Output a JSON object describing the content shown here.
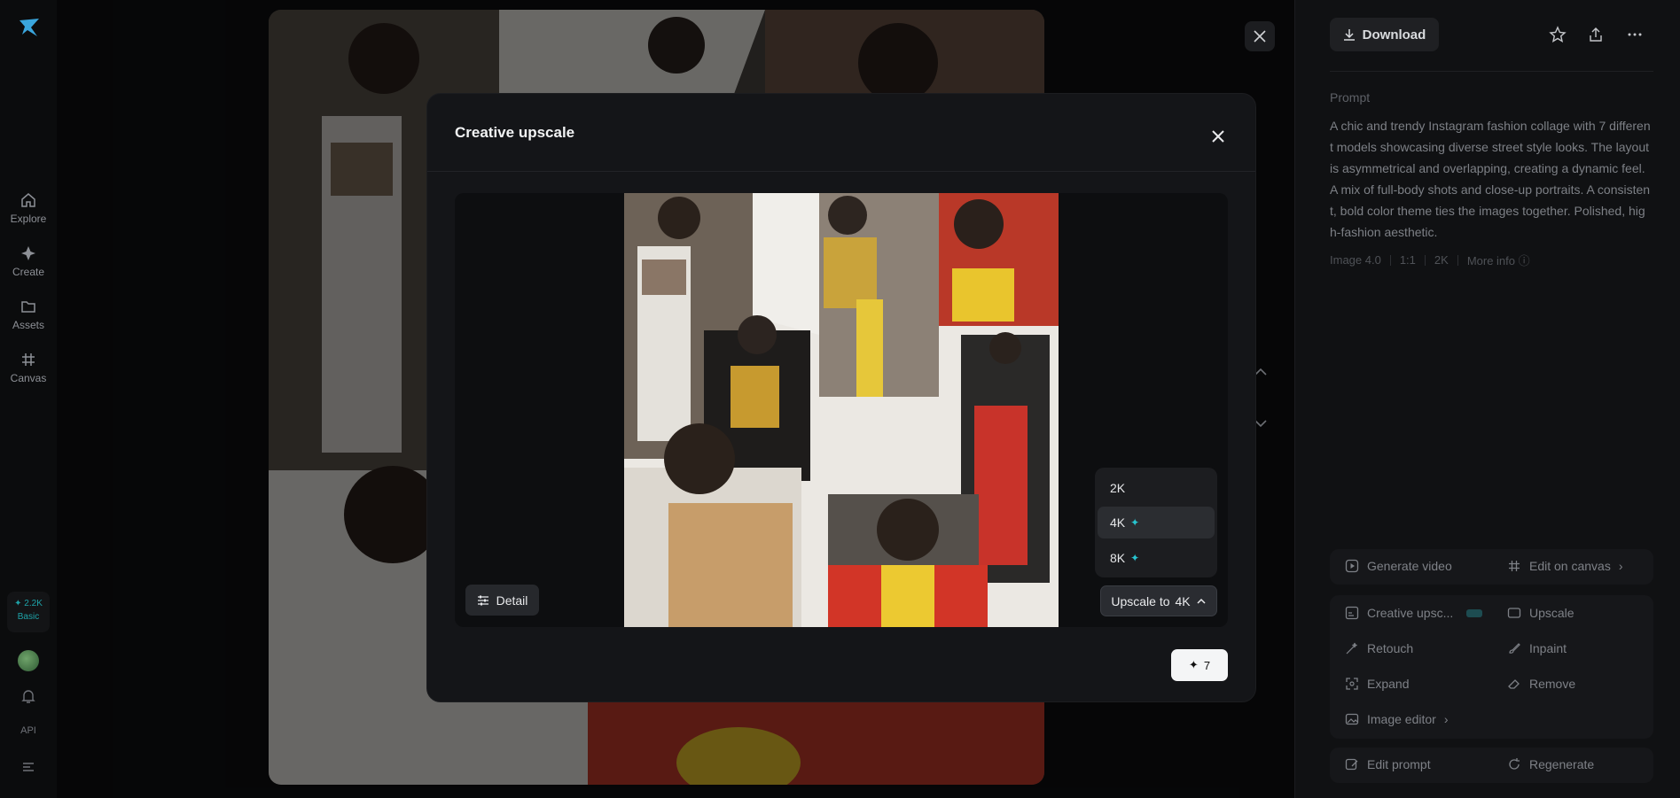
{
  "nav": {
    "items": [
      {
        "label": "Explore",
        "icon": "home-icon"
      },
      {
        "label": "Create",
        "icon": "sparkle-icon"
      },
      {
        "label": "Assets",
        "icon": "folder-icon"
      },
      {
        "label": "Canvas",
        "icon": "grid-icon"
      }
    ],
    "credits": {
      "amount": "2.2K",
      "plan": "Basic"
    },
    "api_label": "API"
  },
  "panel": {
    "download_label": "Download",
    "prompt_label": "Prompt",
    "prompt_text": "A chic and trendy Instagram fashion collage with 7 different models showcasing diverse street style looks. The layout is asymmetrical and overlapping, creating a dynamic feel. A mix of full-body shots and close-up portraits. A consistent, bold color theme ties the images together. Polished, high-fashion aesthetic.",
    "meta": {
      "model": "Image 4.0",
      "ratio": "1:1",
      "res": "2K",
      "more": "More info"
    },
    "actions_a": {
      "generate_video": "Generate video",
      "edit_on_canvas": "Edit on canvas"
    },
    "actions_b": {
      "creative_upscale": "Creative upsc...",
      "upscale": "Upscale",
      "retouch": "Retouch",
      "inpaint": "Inpaint",
      "expand": "Expand",
      "remove": "Remove",
      "image_editor": "Image editor"
    },
    "actions_c": {
      "edit_prompt": "Edit prompt",
      "regenerate": "Regenerate"
    }
  },
  "modal": {
    "title": "Creative upscale",
    "detail_label": "Detail",
    "options": [
      {
        "label": "2K",
        "pro": false
      },
      {
        "label": "4K",
        "pro": true
      },
      {
        "label": "8K",
        "pro": true
      }
    ],
    "upscale_prefix": "Upscale to",
    "upscale_value": "4K",
    "cost": "7"
  },
  "colors": {
    "accent": "#27c4cf",
    "panel_bg": "#101113",
    "modal_bg": "#141518"
  }
}
